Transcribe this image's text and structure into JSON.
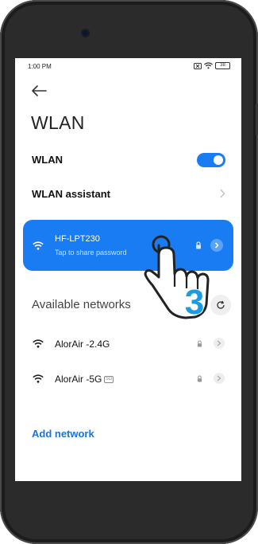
{
  "status_bar": {
    "time": "1:00 PM",
    "battery": "38"
  },
  "page": {
    "title": "WLAN"
  },
  "wlan_row": {
    "label": "WLAN",
    "enabled": true
  },
  "assistant_row": {
    "label": "WLAN assistant"
  },
  "connected": {
    "name": "HF-LPT230",
    "subtitle": "Tap to share password"
  },
  "available": {
    "label": "Available networks"
  },
  "networks": [
    {
      "name": "AlorAir -2.4G",
      "band": ""
    },
    {
      "name": "AlorAir -5G",
      "band": "5G"
    }
  ],
  "add_network": {
    "label": "Add network"
  },
  "overlay": {
    "step_number": "3"
  },
  "colors": {
    "accent": "#1a7cf2",
    "step": "#1a9be3"
  }
}
